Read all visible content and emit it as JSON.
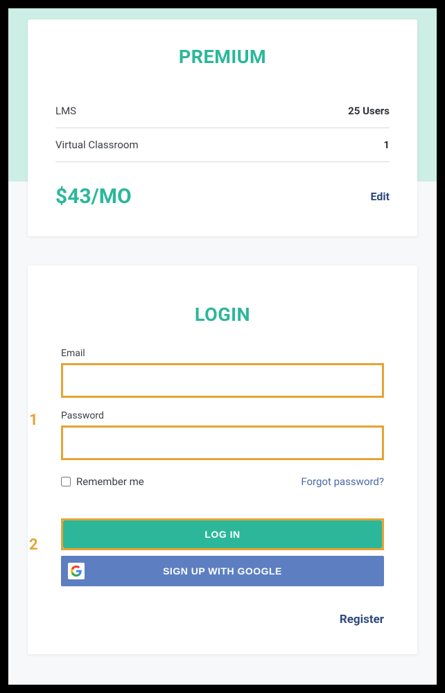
{
  "plan": {
    "title": "PREMIUM",
    "rows": [
      {
        "label": "LMS",
        "value": "25 Users"
      },
      {
        "label": "Virtual Classroom",
        "value": "1"
      }
    ],
    "price": "$43/MO",
    "edit": "Edit"
  },
  "login": {
    "title": "LOGIN",
    "email_label": "Email",
    "password_label": "Password",
    "remember": "Remember me",
    "forgot": "Forgot password?",
    "login_btn": "LOG IN",
    "google_btn": "SIGN UP WITH GOOGLE",
    "register": "Register"
  },
  "callouts": {
    "one": "1",
    "two": "2"
  },
  "colors": {
    "accent": "#2cb79a",
    "highlight": "#e6a332",
    "link": "#2f4a7a",
    "google_blue": "#5d7fc1"
  }
}
